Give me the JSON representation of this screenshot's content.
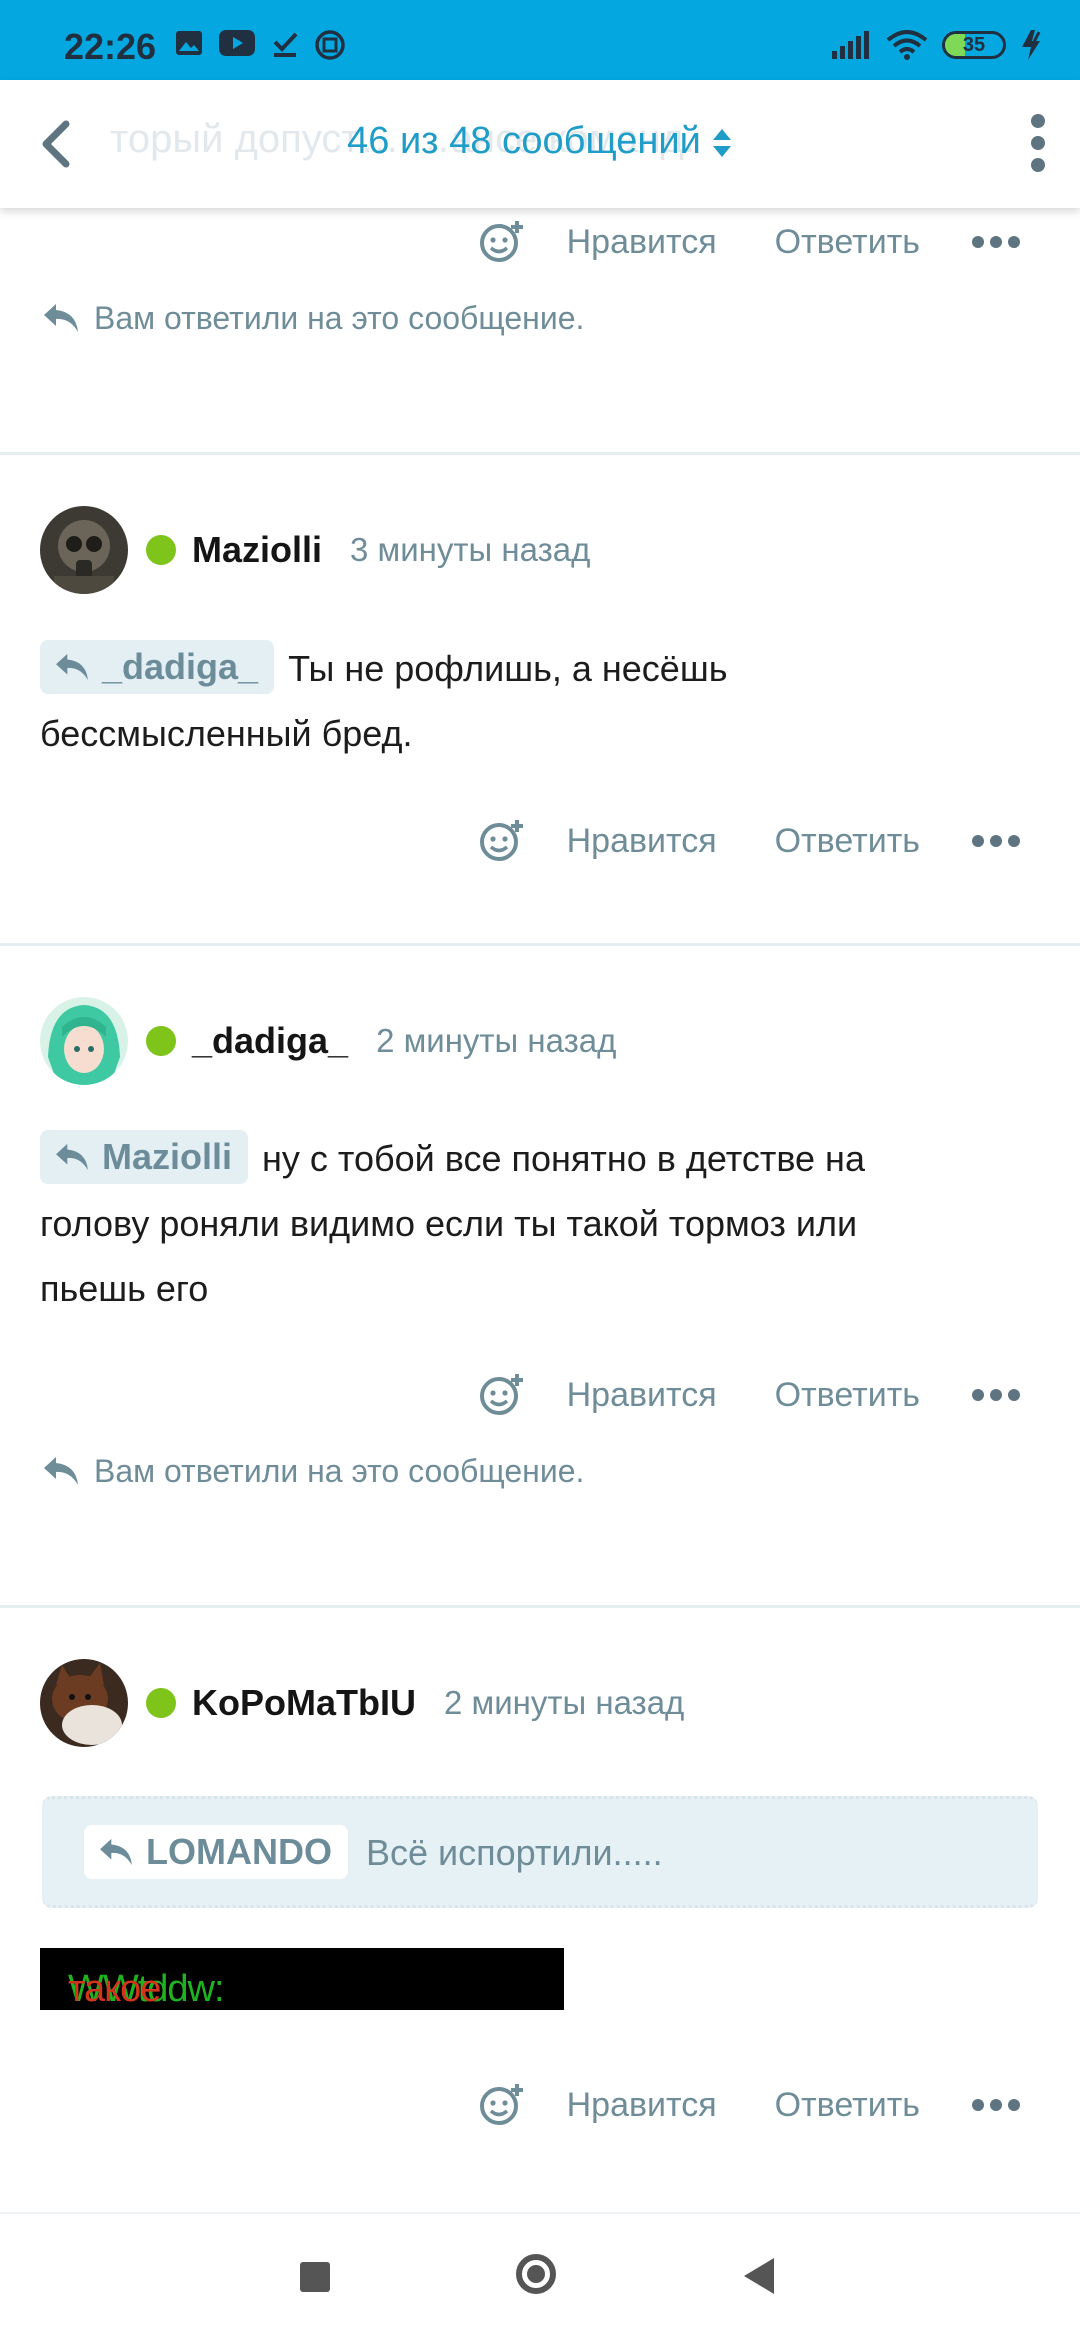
{
  "status_bar": {
    "time": "22:26",
    "battery": "35"
  },
  "header": {
    "ghost_text": "торый допуст… …ансе команд.",
    "counter": "46 из 48 сообщений"
  },
  "actions": {
    "like": "Нравится",
    "reply": "Ответить"
  },
  "notice": "Вам ответили на это сообщение.",
  "posts": [
    {
      "author": "Maziolli",
      "ago": "3 минуты назад",
      "mention": "_dadiga_",
      "text_first": "Ты не рофлишь, а несёшь",
      "text_rest": "бессмысленный бред."
    },
    {
      "author": "_dadiga_",
      "ago": "2 минуты назад",
      "mention": "Maziolli",
      "text_first": "ну с тобой все понятно в детстве на",
      "text_rest1": "голову роняли видимо если ты такой тормоз или",
      "text_rest2": "пьешь его"
    },
    {
      "author": "KoPoMaTbIU",
      "ago": "2 минуты назад",
      "quote_user": "LOMANDO",
      "quote_text": "Всё испортили.....",
      "gif_green": "WWtddw:",
      "gif_red": "такое бывает"
    }
  ],
  "colors": {
    "accent": "#1f9dc8",
    "status_bar": "#04a7e0",
    "online": "#7ec41a",
    "muted": "#6f8c99"
  }
}
